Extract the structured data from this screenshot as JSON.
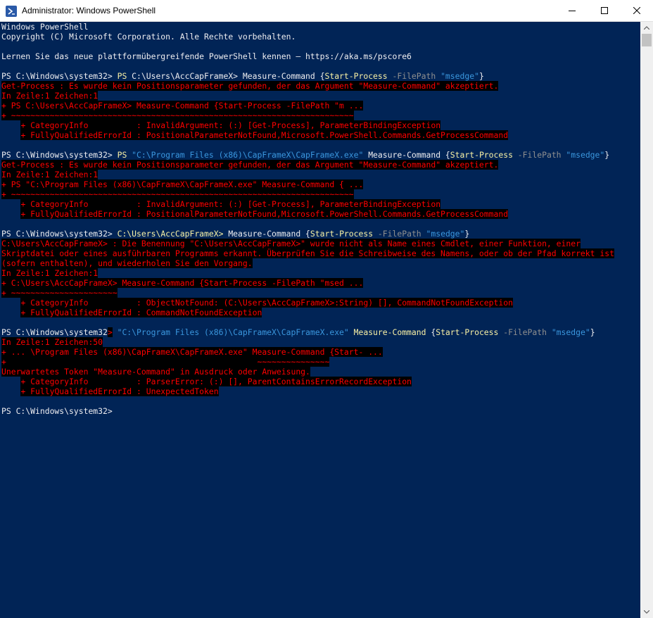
{
  "window": {
    "title": "Administrator: Windows PowerShell",
    "icon": "powershell-icon"
  },
  "colors": {
    "console_bg": "#012456",
    "text": "#eeedf0",
    "command": "#f9f1a5",
    "parameter": "#8f8f8f",
    "string": "#3a96dd",
    "error": "#ff0000"
  },
  "console": {
    "lines": [
      [
        {
          "t": "Windows PowerShell",
          "c": "white"
        }
      ],
      [
        {
          "t": "Copyright (C) Microsoft Corporation. Alle Rechte vorbehalten.",
          "c": "white"
        }
      ],
      [],
      [
        {
          "t": "Lernen Sie das neue plattformübergreifende PowerShell kennen – https://aka.ms/pscore6",
          "c": "white"
        }
      ],
      [],
      [
        {
          "t": "PS C:\\Windows\\system32> ",
          "c": "white"
        },
        {
          "t": "PS",
          "c": "yellow"
        },
        {
          "t": " C:\\Users\\AccCapFrameX> Measure-Command {",
          "c": "white"
        },
        {
          "t": "Start-Process",
          "c": "yellow"
        },
        {
          "t": " -FilePath ",
          "c": "gray"
        },
        {
          "t": "\"msedge\"",
          "c": "cyan"
        },
        {
          "t": "}",
          "c": "white"
        }
      ],
      [
        {
          "t": "Get-Process : Es wurde kein Positionsparameter gefunden, der das Argument \"Measure-Command\" akzeptiert.",
          "c": "red"
        }
      ],
      [
        {
          "t": "In Zeile:1 Zeichen:1",
          "c": "red"
        }
      ],
      [
        {
          "t": "+ PS C:\\Users\\AccCapFrameX> Measure-Command {Start-Process -FilePath \"m ...",
          "c": "red"
        }
      ],
      [
        {
          "t": "+ ~~~~~~~~~~~~~~~~~~~~~~~~~~~~~~~~~~~~~~~~~~~~~~~~~~~~~~~~~~~~~~~~~~~~~~~",
          "c": "red"
        }
      ],
      [
        {
          "t": "    ",
          "c": "white"
        },
        {
          "t": "+ CategoryInfo          : InvalidArgument: (:) [Get-Process], ParameterBindingException",
          "c": "red"
        }
      ],
      [
        {
          "t": "    ",
          "c": "white"
        },
        {
          "t": "+ FullyQualifiedErrorId : PositionalParameterNotFound,Microsoft.PowerShell.Commands.GetProcessCommand",
          "c": "red"
        }
      ],
      [],
      [
        {
          "t": "PS C:\\Windows\\system32> ",
          "c": "white"
        },
        {
          "t": "PS",
          "c": "yellow"
        },
        {
          "t": " ",
          "c": "white"
        },
        {
          "t": "\"C:\\Program Files (x86)\\CapFrameX\\CapFrameX.exe\"",
          "c": "cyan"
        },
        {
          "t": " Measure-Command {",
          "c": "white"
        },
        {
          "t": "Start-Process",
          "c": "yellow"
        },
        {
          "t": " -FilePath ",
          "c": "gray"
        },
        {
          "t": "\"msedge\"",
          "c": "cyan"
        },
        {
          "t": "}",
          "c": "white"
        }
      ],
      [
        {
          "t": "Get-Process : Es wurde kein Positionsparameter gefunden, der das Argument \"Measure-Command\" akzeptiert.",
          "c": "red"
        }
      ],
      [
        {
          "t": "In Zeile:1 Zeichen:1",
          "c": "red"
        }
      ],
      [
        {
          "t": "+ PS \"C:\\Program Files (x86)\\CapFrameX\\CapFrameX.exe\" Measure-Command { ...",
          "c": "red"
        }
      ],
      [
        {
          "t": "+ ~~~~~~~~~~~~~~~~~~~~~~~~~~~~~~~~~~~~~~~~~~~~~~~~~~~~~~~~~~~~~~~~~~~~~~~",
          "c": "red"
        }
      ],
      [
        {
          "t": "    ",
          "c": "white"
        },
        {
          "t": "+ CategoryInfo          : InvalidArgument: (:) [Get-Process], ParameterBindingException",
          "c": "red"
        }
      ],
      [
        {
          "t": "    ",
          "c": "white"
        },
        {
          "t": "+ FullyQualifiedErrorId : PositionalParameterNotFound,Microsoft.PowerShell.Commands.GetProcessCommand",
          "c": "red"
        }
      ],
      [],
      [
        {
          "t": "PS C:\\Windows\\system32> ",
          "c": "white"
        },
        {
          "t": "C:\\Users\\AccCapFrameX>",
          "c": "yellow"
        },
        {
          "t": " Measure-Command {",
          "c": "white"
        },
        {
          "t": "Start-Process",
          "c": "yellow"
        },
        {
          "t": " -FilePath ",
          "c": "gray"
        },
        {
          "t": "\"msedge\"",
          "c": "cyan"
        },
        {
          "t": "}",
          "c": "white"
        }
      ],
      [
        {
          "t": "C:\\Users\\AccCapFrameX> : Die Benennung \"C:\\Users\\AccCapFrameX>\" wurde nicht als Name eines Cmdlet, einer Funktion, einer",
          "c": "red"
        }
      ],
      [
        {
          "t": "Skriptdatei oder eines ausführbaren Programms erkannt. Überprüfen Sie die Schreibweise des Namens, oder ob der Pfad korrekt ist",
          "c": "red"
        }
      ],
      [
        {
          "t": "(sofern enthalten), und wiederholen Sie den Vorgang.",
          "c": "red"
        }
      ],
      [
        {
          "t": "In Zeile:1 Zeichen:1",
          "c": "red"
        }
      ],
      [
        {
          "t": "+ C:\\Users\\AccCapFrameX> Measure-Command {Start-Process -FilePath \"msed ...",
          "c": "red"
        }
      ],
      [
        {
          "t": "+ ~~~~~~~~~~~~~~~~~~~~~~",
          "c": "red"
        }
      ],
      [
        {
          "t": "    ",
          "c": "white"
        },
        {
          "t": "+ CategoryInfo          : ObjectNotFound: (C:\\Users\\AccCapFrameX>:String) [], CommandNotFoundException",
          "c": "red"
        }
      ],
      [
        {
          "t": "    ",
          "c": "white"
        },
        {
          "t": "+ FullyQualifiedErrorId : CommandNotFoundException",
          "c": "red"
        }
      ],
      [],
      [
        {
          "t": "PS C:\\Windows\\system32",
          "c": "white"
        },
        {
          "t": ">",
          "c": "red"
        },
        {
          "t": " ",
          "c": "white"
        },
        {
          "t": "\"C:\\Program Files (x86)\\CapFrameX\\CapFrameX.exe\"",
          "c": "cyan"
        },
        {
          "t": " ",
          "c": "white"
        },
        {
          "t": "Measure-Command",
          "c": "yellow"
        },
        {
          "t": " {",
          "c": "white"
        },
        {
          "t": "Start-Process",
          "c": "yellow"
        },
        {
          "t": " -FilePath ",
          "c": "gray"
        },
        {
          "t": "\"msedge\"",
          "c": "cyan"
        },
        {
          "t": "}",
          "c": "white"
        }
      ],
      [
        {
          "t": "In Zeile:1 Zeichen:50",
          "c": "red"
        }
      ],
      [
        {
          "t": "+ ... \\Program Files (x86)\\CapFrameX\\CapFrameX.exe\" Measure-Command {Start- ...",
          "c": "red"
        }
      ],
      [
        {
          "t": "+                                                    ~~~~~~~~~~~~~~~",
          "c": "red"
        }
      ],
      [
        {
          "t": "Unerwartetes Token \"Measure-Command\" in Ausdruck oder Anweisung.",
          "c": "red"
        }
      ],
      [
        {
          "t": "    ",
          "c": "white"
        },
        {
          "t": "+ CategoryInfo          : ParserError: (:) [], ParentContainsErrorRecordException",
          "c": "red"
        }
      ],
      [
        {
          "t": "    ",
          "c": "white"
        },
        {
          "t": "+ FullyQualifiedErrorId : UnexpectedToken",
          "c": "red"
        }
      ],
      [],
      [
        {
          "t": "PS C:\\Windows\\system32>",
          "c": "white"
        }
      ]
    ]
  }
}
